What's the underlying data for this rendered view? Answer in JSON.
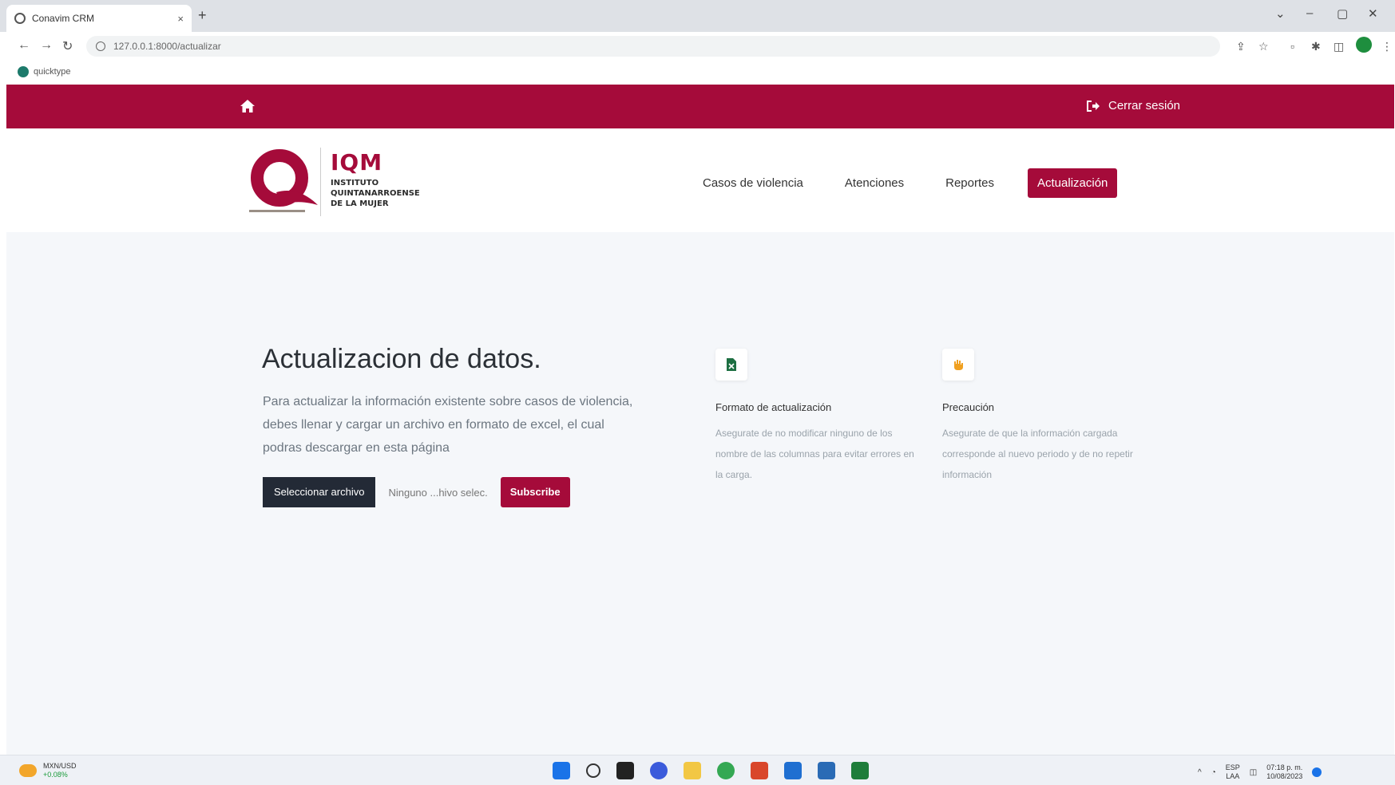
{
  "browser": {
    "tab_title": "Conavim CRM",
    "tab_close": "×",
    "new_tab": "+",
    "url": "127.0.0.1:8000/actualizar",
    "bookmark": "quicktype",
    "controls": {
      "minimize": "–",
      "maximize": "▢",
      "close": "✕",
      "dropdown": "⌄"
    }
  },
  "topbar": {
    "logout_label": "Cerrar sesión"
  },
  "brand": {
    "acronym": "IQM",
    "line1": "INSTITUTO",
    "line2": "QUINTANARROENSE",
    "line3": "DE LA MUJER",
    "color": "#a50b3a"
  },
  "nav": {
    "items": [
      {
        "label": "Casos de violencia"
      },
      {
        "label": "Atenciones"
      },
      {
        "label": "Reportes"
      },
      {
        "label": "Actualización"
      }
    ]
  },
  "main": {
    "title": "Actualizacion de datos.",
    "description": "Para actualizar la información existente sobre casos de violencia, debes llenar y cargar un archivo en formato de excel, el cual podras descargar en esta página",
    "file_button": "Seleccionar archivo",
    "file_none": "Ninguno ...hivo selec.",
    "submit": "Subscribe"
  },
  "features": [
    {
      "icon": "excel-file-icon",
      "title": "Formato de actualización",
      "text": "Asegurate de no modificar ninguno de los nombre de las columnas para evitar errores en la carga."
    },
    {
      "icon": "hand-icon",
      "title": "Precaución",
      "text": "Asegurate de que la información cargada corresponde al nuevo periodo y de no repetir información"
    }
  ],
  "taskbar": {
    "weather_line1": "MXN/USD",
    "weather_line2": "+0.08%",
    "lang_line1": "ESP",
    "lang_line2": "LAA",
    "time": "07:18 p. m.",
    "date": "10/08/2023"
  }
}
